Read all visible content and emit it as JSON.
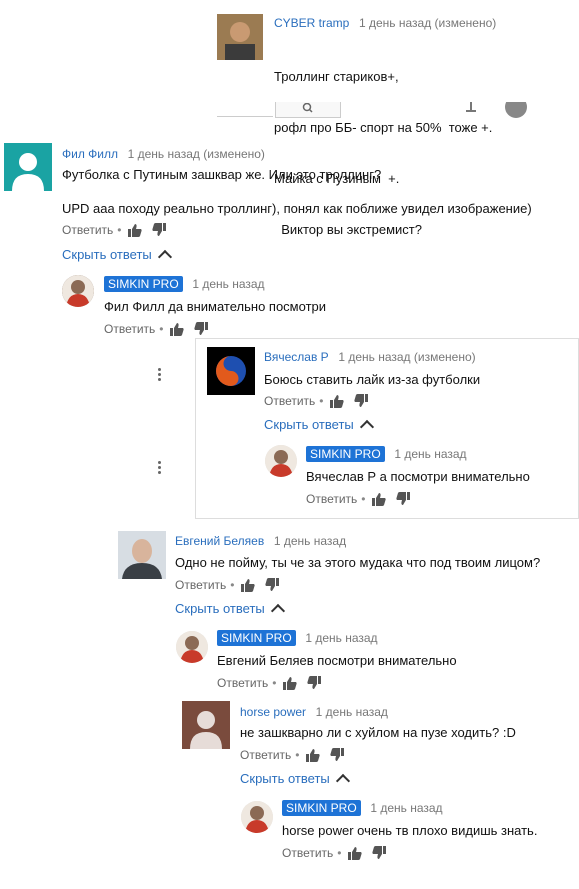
{
  "top": {
    "name": "CYBER tramp",
    "meta": "1 день назад (изменено)",
    "lines": [
      "Троллинг стариков+,",
      "рофл про ББ- спорт на 50%  тоже +.",
      "Майка с Пузиным  +.",
      "  Виктор вы экстремист?"
    ]
  },
  "c1": {
    "name": "Фил Филл",
    "meta": "1 день назад (изменено)",
    "line1": "Футболка с Путиным зашквар же. Или это троллинг?",
    "line2": "UPD ааа походу реально троллинг), понял как поближе увидел изображение)",
    "reply": "Ответить",
    "hide": "Скрыть ответы"
  },
  "r1": {
    "name": "SIMKIN PRO",
    "meta": "1 день назад",
    "text": "Фил Филл да внимательно посмотри",
    "reply": "Ответить"
  },
  "c2": {
    "name": "Вячеслав Р",
    "meta": "1 день назад (изменено)",
    "text": "Боюсь ставить лайк из-за футболки",
    "reply": "Ответить",
    "hide": "Скрыть ответы"
  },
  "r2": {
    "name": "SIMKIN PRO",
    "meta": "1 день назад",
    "text": "Вячеслав Р а посмотри внимательно",
    "reply": "Ответить"
  },
  "c3": {
    "name": "Евгений Беляев",
    "meta": "1 день назад",
    "text": "Одно не пойму, ты че за этого мудака что под твоим лицом?",
    "reply": "Ответить",
    "hide": "Скрыть ответы"
  },
  "r3": {
    "name": "SIMKIN PRO",
    "meta": "1 день назад",
    "text": "Евгений Беляев посмотри внимательно",
    "reply": "Ответить"
  },
  "c4": {
    "name": "horse power",
    "meta": "1 день назад",
    "text": "не зашкварно ли с хуйлом на пузе ходить? :D",
    "reply": "Ответить",
    "hide": "Скрыть ответы"
  },
  "r4": {
    "name": "SIMKIN PRO",
    "meta": "1 день назад",
    "text": "horse power очень тв плохо видишь знать.",
    "reply": "Ответить"
  },
  "colors": {
    "link": "#2a6ebd",
    "badge": "#1e73d6",
    "avatar_teal": "#1aa3a3"
  }
}
